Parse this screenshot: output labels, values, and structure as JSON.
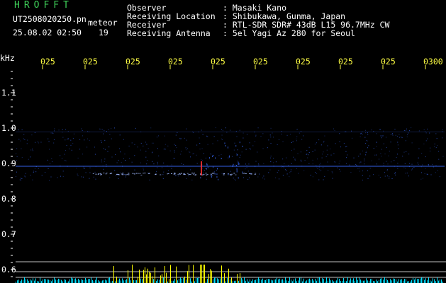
{
  "header": {
    "brand": "HROFFT",
    "filename": "UT2508020250.pn",
    "mode": "meteor",
    "datetime": "25.08.02 02:50",
    "count": "19",
    "info_labels": [
      "Observer",
      "Receiving Location",
      "Receiver",
      "Receiving Antenna"
    ],
    "info_values": [
      ": Masaki Kano",
      ": Shibukawa, Gunma, Japan",
      ": RTL-SDR SDR# 43dB L15 96.7MHz CW",
      ": 5el Yagi Az 280 for Seoul"
    ]
  },
  "axes": {
    "y_unit": "kHz",
    "y_ticks": [
      "1.1",
      "1.0",
      "0.9",
      "0.8",
      "0.7",
      "0.6"
    ],
    "x_ticks": [
      "025",
      "025",
      "025",
      "025",
      "025",
      "025",
      "025",
      "025",
      "025",
      "0300"
    ]
  },
  "colors": {
    "background": "#000000",
    "text": "#ffffff",
    "brand": "#3fd25a",
    "tick_labels": "#ffff44",
    "signal": "#3a6bff",
    "hot_signal": "#ff3030",
    "spectrum_low": "#00e0ff",
    "spectrum_high": "#ffff00"
  }
}
